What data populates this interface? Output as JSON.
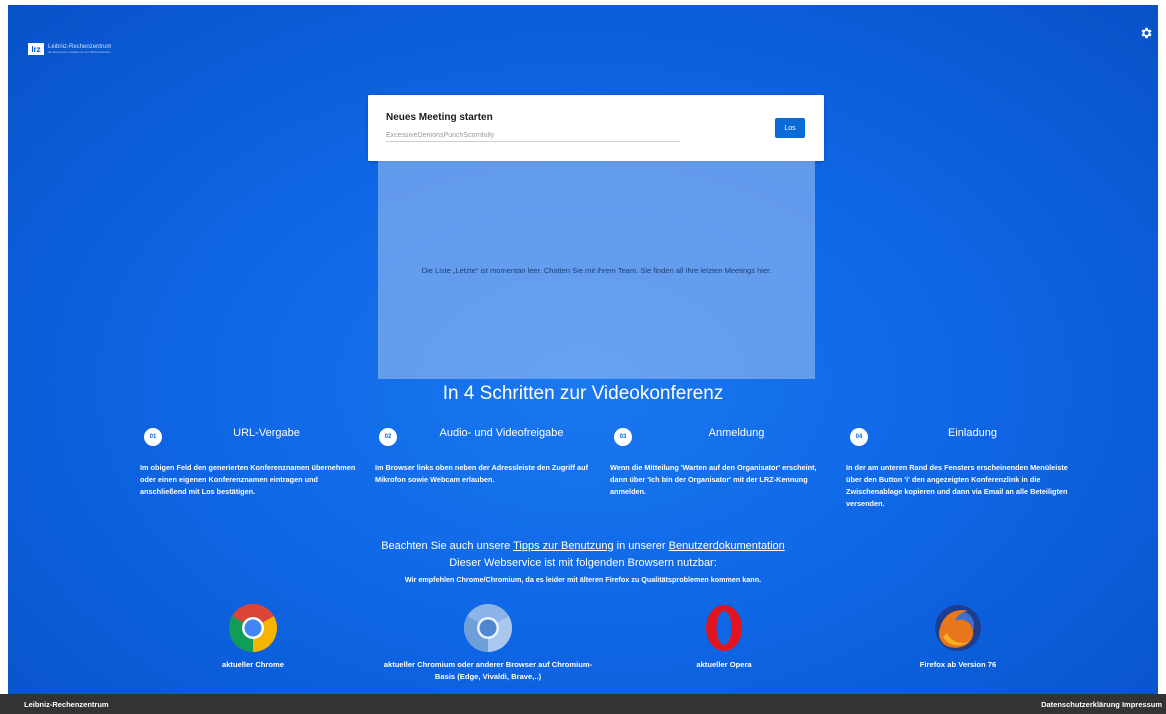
{
  "header": {
    "logo_mark": "lrz",
    "logo_text": "Leibniz-Rechenzentrum",
    "logo_sub": "der Bayerischen Akademie der Wissenschaften",
    "settings_icon": "gear-icon"
  },
  "meeting": {
    "title": "Neues Meeting starten",
    "input_placeholder": "ExcessiveDemonsPunchScornfully",
    "go_label": "Los"
  },
  "recent": {
    "empty_text": "Die Liste „Letzte“ ist momentan leer. Chatten Sie mit ihrem Team. Sie finden all Ihre letzten Meetings hier."
  },
  "steps": {
    "heading": "In 4 Schritten zur Videokonferenz",
    "items": [
      {
        "num": "01",
        "title": "URL-Vergabe",
        "text": "Im obigen Feld den generierten Konferenznamen übernehmen oder einen eigenen Konferenznamen eintragen und anschließend mit Los bestätigen."
      },
      {
        "num": "02",
        "title": "Audio- und Videofreigabe",
        "text": "Im Browser links oben neben der Adressleiste den Zugriff auf Mikrofon sowie Webcam erlauben."
      },
      {
        "num": "03",
        "title": "Anmeldung",
        "text": "Wenn die Mitteilung 'Warten auf den Organisator' erscheint, dann über 'Ich bin der Organisator' mit der LRZ-Kennung anmelden."
      },
      {
        "num": "04",
        "title": "Einladung",
        "text": "In der am unteren Rand des Fensters erscheinenden Menüleiste über den Button 'i' den angezeigten Konferenzlink in die Zwischenablage kopieren und dann via Email an alle Beteiligten versenden."
      }
    ]
  },
  "notes": {
    "tips_prefix": "Beachten Sie auch unsere ",
    "tips_link": "Tipps zur Benutzung",
    "tips_middle": " in unserer ",
    "docs_link": "Benutzerdokumentation",
    "browsers_heading": "Dieser Webservice ist mit folgenden Browsern nutzbar:",
    "recommendation": "Wir empfehlen Chrome/Chromium, da es leider mit älteren Firefox zu Qualitätsproblemen kommen kann."
  },
  "browsers": [
    {
      "icon": "chrome-icon",
      "label": "aktueller Chrome"
    },
    {
      "icon": "chromium-icon",
      "label": "aktueller Chromium oder anderer Browser auf Chromium-Basis (Edge, Vivaldi, Brave,..)"
    },
    {
      "icon": "opera-icon",
      "label": "aktueller Opera"
    },
    {
      "icon": "firefox-icon",
      "label": "Firefox ab Version 76"
    }
  ],
  "footer": {
    "left": "Leibniz-Rechenzentrum",
    "privacy": "Datenschutzerklärung",
    "imprint": "Impressum"
  },
  "colors": {
    "background": "#0f67e6",
    "accent_button": "#0b6bd6",
    "footer": "#333333"
  }
}
